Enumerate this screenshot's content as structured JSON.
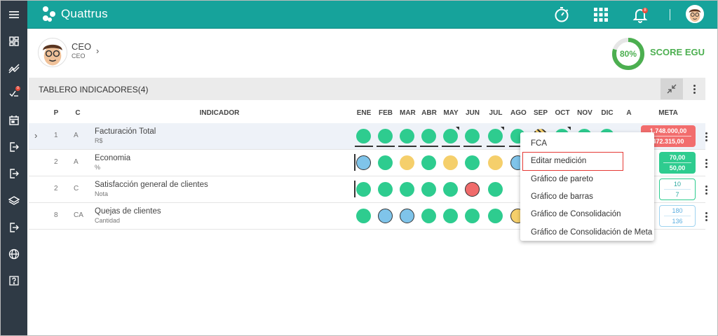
{
  "app": {
    "name": "Quattrus"
  },
  "sidebar": {
    "icons": [
      "menu-icon",
      "dashboard-icon",
      "trend-icon",
      "tasks-icon",
      "calendar-icon",
      "exit-icon",
      "exit-icon",
      "layers-icon",
      "exit-icon",
      "globe-icon",
      "help-icon"
    ],
    "badge": "0"
  },
  "topbar": {
    "notif_count": "8",
    "accent": "#16a39b"
  },
  "profile": {
    "name": "CEO",
    "role": "CEO"
  },
  "score": {
    "value": "80%",
    "fraction": 0.8,
    "label": "SCORE EGU",
    "color": "#4caf50"
  },
  "board": {
    "title": "TABLERO INDICADORES(4)"
  },
  "columns": {
    "p": "P",
    "c": "C",
    "indicator": "INDICADOR",
    "months": [
      "ENE",
      "FEB",
      "MAR",
      "ABR",
      "MAY",
      "JUN",
      "JUL",
      "AGO",
      "SEP",
      "OCT",
      "NOV",
      "DIC",
      "A"
    ],
    "meta": "META"
  },
  "colors": {
    "green": "#2ecc8f",
    "blue": "#7fc4ea",
    "yellow": "#f5cf6b",
    "red": "#f06b6b",
    "meta_red": "#f26d6d",
    "meta_green": "#2ecc8f"
  },
  "rows": [
    {
      "p": "1",
      "c": "A",
      "name": "Facturación Total",
      "unit": "R$",
      "meta_top": "1.748.000,00",
      "meta_bottom": "472.315,00",
      "dots": [
        "green",
        "green",
        "green",
        "green",
        "green",
        "green",
        "green",
        "green",
        "hatched",
        "green",
        "green",
        "green"
      ]
    },
    {
      "p": "2",
      "c": "A",
      "name": "Economia",
      "unit": "%",
      "meta_top": "70,00",
      "meta_bottom": "50,00",
      "dots": [
        "blue",
        "green",
        "yellow",
        "green",
        "yellow",
        "green",
        "yellow",
        "blue",
        "",
        "",
        "",
        "",
        ""
      ]
    },
    {
      "p": "2",
      "c": "C",
      "name": "Satisfacción general de clientes",
      "unit": "Nota",
      "meta_top": "10",
      "meta_bottom": "7",
      "dots": [
        "green",
        "green",
        "green",
        "green",
        "green",
        "red",
        "green",
        "",
        "",
        "",
        "",
        "",
        ""
      ]
    },
    {
      "p": "8",
      "c": "CA",
      "name": "Quejas de clientes",
      "unit": "Cantidad",
      "meta_top": "180",
      "meta_bottom": "136",
      "dots": [
        "green",
        "blue",
        "blue",
        "green",
        "green",
        "green",
        "green",
        "yellow",
        "",
        "",
        "",
        "",
        ""
      ]
    }
  ],
  "context_menu": {
    "items": [
      "FCA",
      "Editar medición",
      "Gráfico de pareto",
      "Gráfico de barras",
      "Gráfico de Consolidación",
      "Gráfico de Consolidación de Meta"
    ],
    "highlighted": 1
  }
}
